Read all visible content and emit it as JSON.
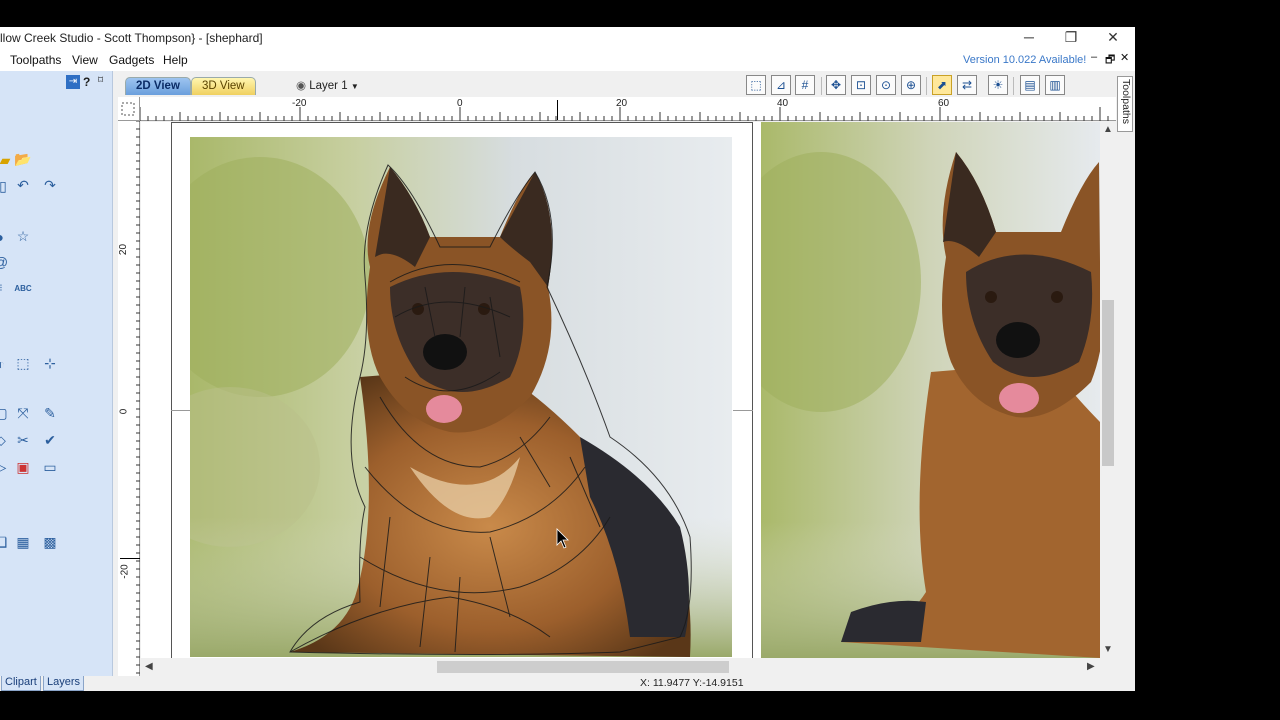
{
  "window": {
    "title": "llow Creek Studio - Scott Thompson} - [shephard]",
    "minimize": "─",
    "restore": "❐",
    "close": "✕"
  },
  "menu": {
    "items": [
      "Toolpaths",
      "View",
      "Gadgets",
      "Help"
    ],
    "version_notice": "Version 10.022 Available!",
    "mdi_min": "–",
    "mdi_restore": "🗗",
    "mdi_close": "✕"
  },
  "left_panel": {
    "help_button": "?",
    "pin_button": "⌑",
    "icons": [
      "open-folder-icon",
      "undo-icon",
      "redo-icon",
      "star-icon",
      "text-abc-icon",
      "transform-icon",
      "align-center-icon",
      "mirror-icon",
      "scissors-icon",
      "pen-icon",
      "image-icon",
      "grid-icon",
      "wrap-icon"
    ],
    "tabs": [
      "Clipart",
      "Layers"
    ]
  },
  "toolbar": {
    "tab_2d": "2D View",
    "tab_3d": "3D View",
    "layer_label": "Layer 1",
    "icons": [
      "snap-icon",
      "measure-icon",
      "grid-icon",
      "pan-icon",
      "zoom-box-icon",
      "zoom-fit-icon",
      "zoom-all-icon",
      "select-icon",
      "transform-icon",
      "light-icon",
      "split-h-icon",
      "split-v-icon"
    ],
    "active_icon": "select-icon"
  },
  "ruler": {
    "h_labels": [
      "-20",
      "0",
      "20",
      "40",
      "60"
    ],
    "v_labels": [
      "20",
      "0",
      "-20"
    ]
  },
  "right_strip": {
    "toolpaths_tab": "Toolpaths"
  },
  "status": {
    "coordinates": "X: 11.9477 Y:-14.9151"
  }
}
